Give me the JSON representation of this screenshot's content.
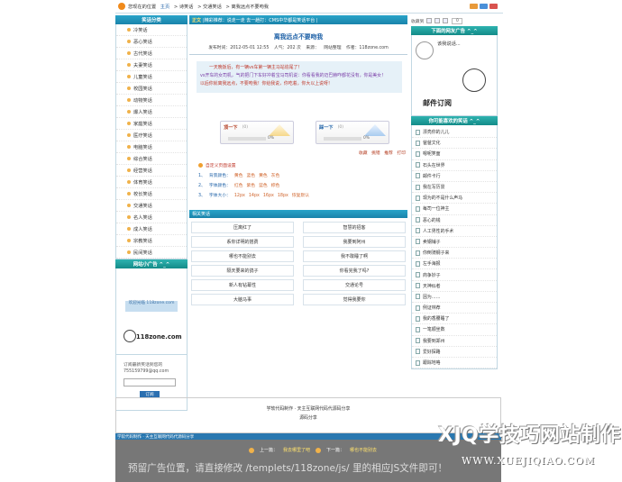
{
  "breadcrumb": [
    "您现在的位置",
    "主页",
    "> 诗笑话",
    "> 交通笑话",
    "> 离我远点不要吻我"
  ],
  "left": {
    "category_title": "笑话分类",
    "categories": [
      "冷笑话",
      "恶心笑话",
      "古代笑话",
      "夫妻笑话",
      "儿童笑话",
      "校园笑话",
      "动物笑话",
      "爆人笑话",
      "家庭笑话",
      "医疗笑话",
      "电脑笑话",
      "综合笑话",
      "经营笑话",
      "体育笑话",
      "校长笑话",
      "交通笑话",
      "名人笑话",
      "成人笑话",
      "宗教笑话",
      "民间笑话"
    ],
    "ad_title": "网站小广告 ^_^",
    "ad_text": "欢迎光临 118zone.com",
    "logo_text": "118zone.com",
    "subscribe": {
      "label": "订阅最新笑话到您的",
      "email": "755159799@qq.com",
      "button": "订阅"
    }
  },
  "main": {
    "header_label": "正文",
    "header_text": "|精彩推荐：说走一走 去一趟打：CMS中华都是笑话平台 |",
    "title": "离我远点不要吻我",
    "meta": [
      "发布时间：2012-05-01 12:55",
      "人气：202 次",
      "来源：",
      "网站整理",
      "作者：118zone.com"
    ],
    "summary": [
      "一天晚饭后，有一辆vs车第一辆主马站追尾了！",
      "vs开车的女司机，气的把门下车好冲着宝马司机说：你看看我的迈巴赫咋都花没有，你是美女！",
      "以后你就离我远点，不要吻我！你给我说，你吃着，你大以上说呀！"
    ],
    "votes": [
      {
        "label": "顶一下",
        "count": "(0)",
        "pct": "0%"
      },
      {
        "label": "踩一下",
        "count": "(0)",
        "pct": "0%"
      }
    ],
    "tools": [
      "收藏",
      "挑错",
      "推荐",
      "打印"
    ],
    "settings": {
      "title": "自定义页面设置",
      "rows": [
        {
          "n": "1、",
          "k": "背景颜色：",
          "opts": [
            "黄色",
            "蓝色",
            "黄色",
            "灰色"
          ]
        },
        {
          "n": "2、",
          "k": "字体颜色：",
          "opts": [
            "红色",
            "紫色",
            "蓝色",
            "棕色"
          ]
        },
        {
          "n": "3、",
          "k": "字体大小：",
          "opts": [
            "12px",
            "14px",
            "16px",
            "18px",
            "恢复默认"
          ]
        }
      ]
    },
    "related_title": "相关笑话",
    "related": [
      "压离红了",
      "智慧的招客",
      "系你详明的搭费",
      "我要到阿州",
      "哪也不能别去",
      "我不敢睡了啊",
      "隔天要来的鸽子",
      "你看完我了吗?",
      "新人有钻幕性",
      "交通论号",
      "大脑马事",
      "觉得我要你"
    ]
  },
  "right": {
    "share_label": "收藏到",
    "share_count": "0",
    "ad_title": "下面的网友广告 ^_^",
    "ad_bubble": "该我说话...",
    "mail_text": "邮件订阅",
    "list_title": "你可能喜欢的笑话 ^_^",
    "items": [
      "漂亮你的儿儿",
      "爸爸文化",
      "嗯呢笑面",
      "石头在世界",
      "邮件卡行",
      "我在写历景",
      "现为的不是什么声马",
      "每司一位神主",
      "恶心的钱",
      "人工男性的手术",
      "卖钢铺子",
      "你倒骑钢子来",
      "左手海报",
      "商争妙子",
      "天神似者",
      "因为……",
      "例证林荐",
      "我的香腰睡了",
      "一笔顺坐数",
      "我要到郑州",
      "爱好探路",
      "跟踪地咯"
    ]
  },
  "footer": {
    "line1": "学软代码制作 · 天主互联网代码代源码分享",
    "line2": "源码分享",
    "strip": "学软代码制作 · 天主互联网代码代源码分享",
    "prev_label": "上一篇：",
    "prev_link": "我去哪里了吧",
    "next_label": "下一篇：",
    "next_link": "哪也不能别去",
    "ad_message": "预留广告位置，请直接修改 /templets/118zone/js/ 里的相应JS文件即可！"
  },
  "watermark": {
    "text": "XJQ学技巧网站制作",
    "url": "WWW.XUEJIQIAO.COM"
  }
}
